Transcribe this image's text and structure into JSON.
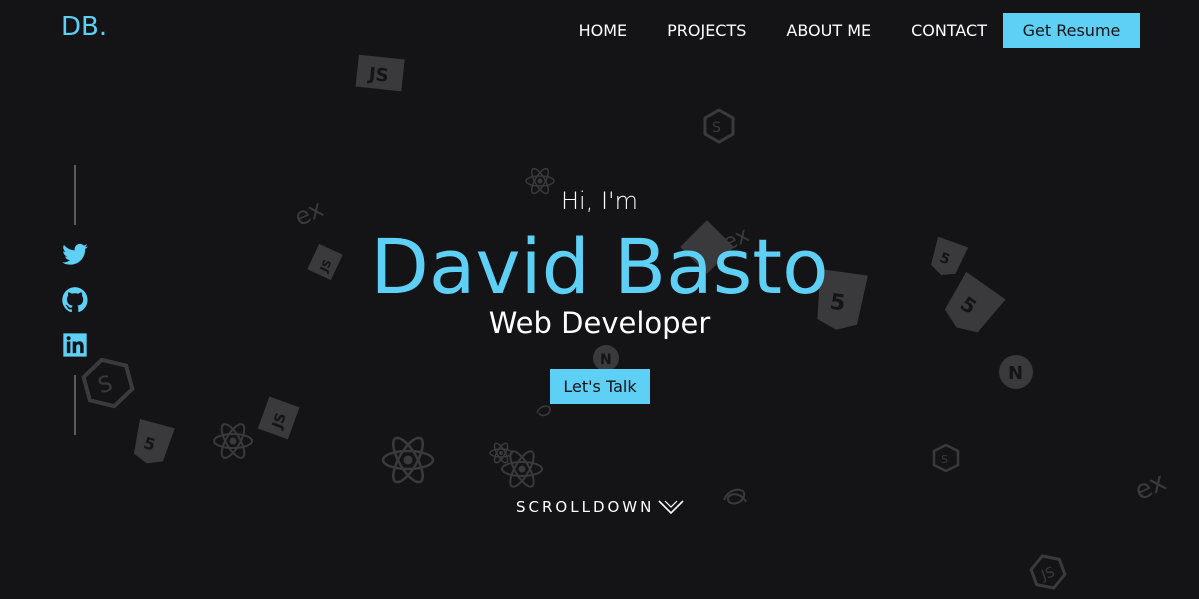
{
  "header": {
    "logo": "DB.",
    "nav": [
      "HOME",
      "PROJECTS",
      "ABOUT ME",
      "CONTACT"
    ],
    "resume_label": "Get Resume"
  },
  "social": {
    "icons": [
      "twitter-icon",
      "github-icon",
      "linkedin-icon"
    ]
  },
  "hero": {
    "greeting": "Hi, I'm",
    "name": "David Basto",
    "role": "Web Developer",
    "cta_label": "Let's Talk",
    "scroll_label": "SCROLLDOWN"
  },
  "colors": {
    "accent": "#5ecff5",
    "background": "#141315",
    "decor": "#3a393c"
  }
}
